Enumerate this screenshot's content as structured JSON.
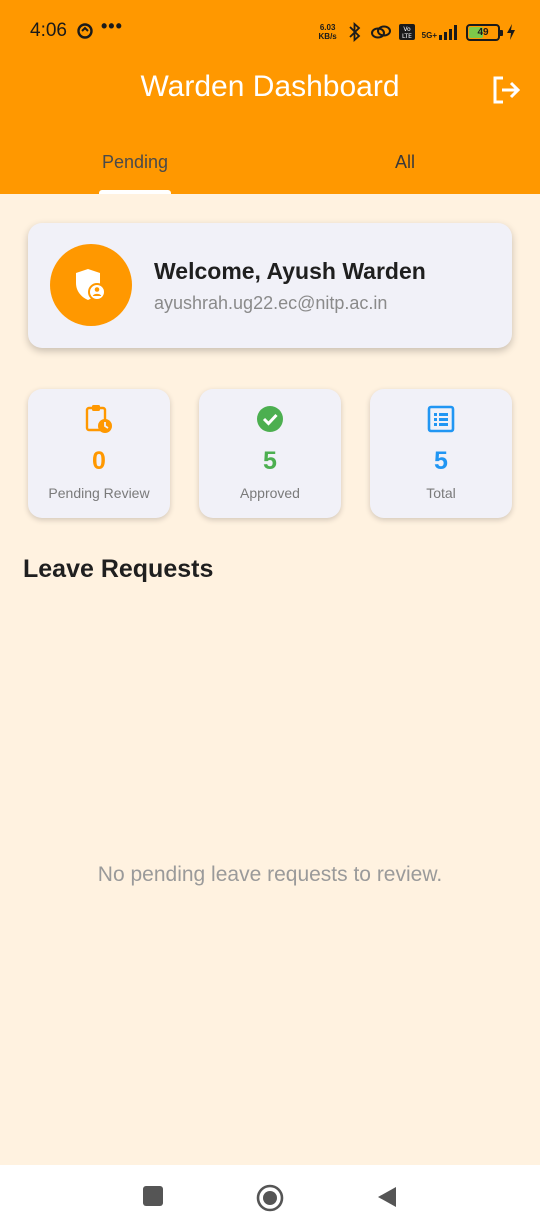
{
  "status_bar": {
    "time": "4:06",
    "more": "•••",
    "net_speed_value": "6.03",
    "net_speed_unit": "KB/s",
    "network": "5G+",
    "battery": "49"
  },
  "app_bar": {
    "title": "Warden Dashboard",
    "logout_icon": "logout-icon",
    "background": "#FF9800"
  },
  "tabs": [
    {
      "label": "Pending",
      "selected": true
    },
    {
      "label": "All",
      "selected": false
    }
  ],
  "welcome": {
    "title": "Welcome, Ayush Warden",
    "email": "ayushrah.ug22.ec@nitp.ac.in",
    "avatar_icon": "admin-shield-icon"
  },
  "stats": [
    {
      "value": "0",
      "label": "Pending Review",
      "icon": "clipboard-clock-icon",
      "color": "#FF9800"
    },
    {
      "value": "5",
      "label": "Approved",
      "icon": "check-circle-icon",
      "color": "#4CAF50"
    },
    {
      "value": "5",
      "label": "Total",
      "icon": "list-icon",
      "color": "#2196F3"
    }
  ],
  "section_title": "Leave Requests",
  "empty_message": "No pending leave requests to review.",
  "nav": {
    "recents_icon": "square-icon",
    "home_icon": "circle-icon",
    "back_icon": "triangle-back-icon"
  }
}
